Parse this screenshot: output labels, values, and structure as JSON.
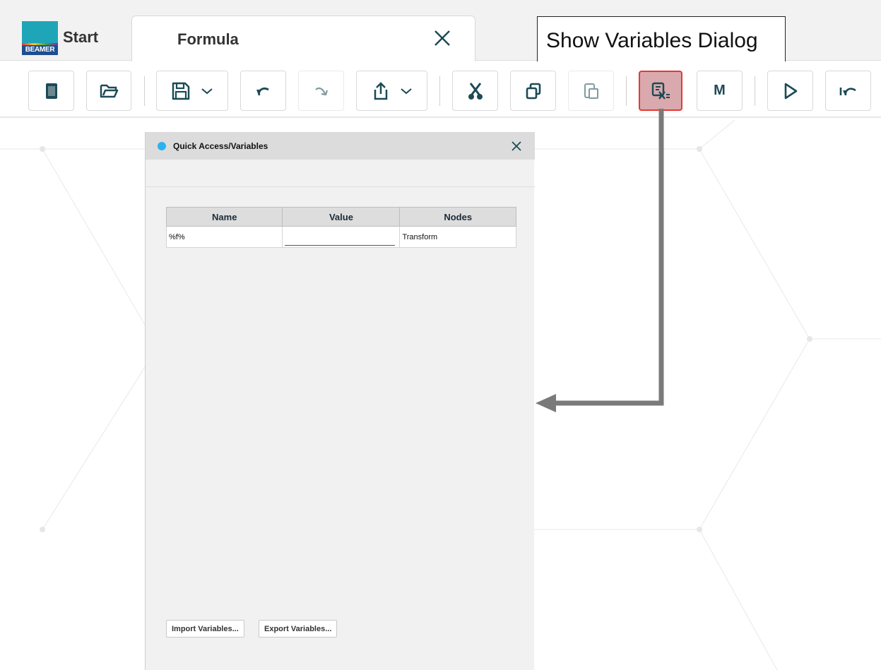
{
  "app": {
    "logo_text": "BEAMER",
    "tabs": [
      {
        "label": "Start"
      },
      {
        "label": "Formula"
      }
    ]
  },
  "tooltip": {
    "text": "Show Variables Dialog"
  },
  "toolbar": {
    "buttons": [
      {
        "icon": "new-document-icon"
      },
      {
        "icon": "open-folder-icon"
      },
      {
        "icon": "save-icon",
        "dropdown": true
      },
      {
        "icon": "undo-icon"
      },
      {
        "icon": "redo-icon",
        "disabled": true
      },
      {
        "icon": "export-icon",
        "dropdown": true
      },
      {
        "icon": "cut-icon"
      },
      {
        "icon": "copy-icon"
      },
      {
        "icon": "paste-icon",
        "disabled": true
      },
      {
        "icon": "variables-icon",
        "highlighted": true
      },
      {
        "label": "M"
      },
      {
        "icon": "run-icon"
      },
      {
        "icon": "step-back-icon"
      }
    ],
    "highlight_color": "#e53935"
  },
  "dialog": {
    "title": "Quick Access/Variables",
    "table": {
      "columns": [
        "Name",
        "Value",
        "Nodes"
      ],
      "rows": [
        {
          "name": "%f%",
          "value": "",
          "nodes": "Transform"
        }
      ]
    },
    "import_label": "Import Variables...",
    "export_label": "Export Variables..."
  }
}
